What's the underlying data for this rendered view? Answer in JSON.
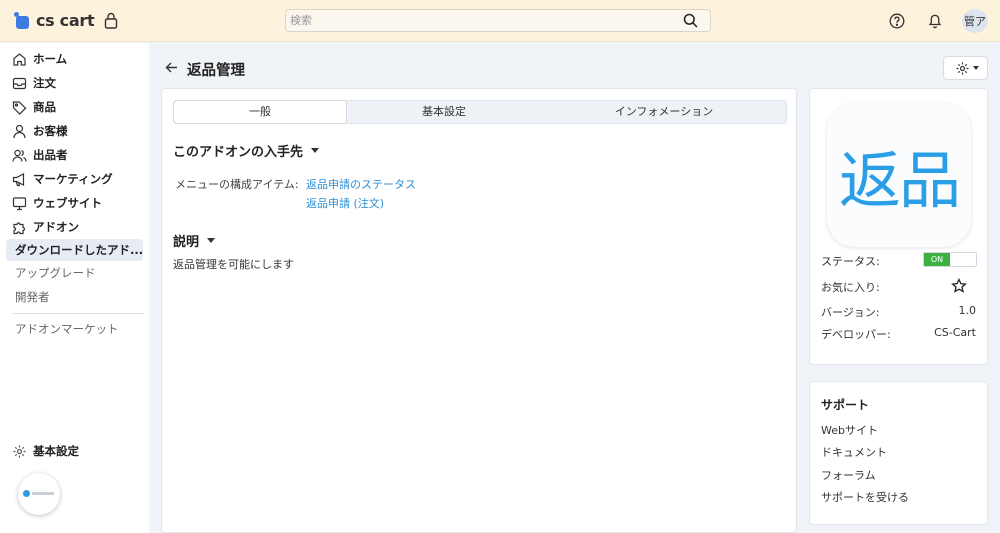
{
  "app": {
    "logo_text": "cs cart"
  },
  "search": {
    "placeholder": "検索"
  },
  "user": {
    "avatar_text": "管ア"
  },
  "sidebar": {
    "items": [
      {
        "label": "ホーム",
        "icon": "home-icon"
      },
      {
        "label": "注文",
        "icon": "inbox-icon"
      },
      {
        "label": "商品",
        "icon": "tag-icon"
      },
      {
        "label": "お客様",
        "icon": "user-icon"
      },
      {
        "label": "出品者",
        "icon": "users-icon"
      },
      {
        "label": "マーケティング",
        "icon": "megaphone-icon"
      },
      {
        "label": "ウェブサイト",
        "icon": "monitor-icon"
      },
      {
        "label": "アドオン",
        "icon": "puzzle-icon"
      }
    ],
    "active_label": "ダウンロードしたアド...",
    "sub_items": [
      "アップグレード",
      "開発者"
    ],
    "marketplace_label": "アドオンマーケット",
    "settings": {
      "label": "基本設定",
      "icon": "gear-icon"
    }
  },
  "page": {
    "title": "返品管理"
  },
  "tabs": [
    {
      "label": "一般",
      "active": true
    },
    {
      "label": "基本設定",
      "active": false
    },
    {
      "label": "インフォメーション",
      "active": false
    }
  ],
  "source_section": {
    "title": "このアドオンの入手先",
    "field_label": "メニューの構成アイテム:",
    "links": [
      "返品申請のステータス",
      "返品申請 (注文)"
    ]
  },
  "description_section": {
    "title": "説明",
    "text": "返品管理を可能にします"
  },
  "info": {
    "icon_text": "返品",
    "status_label": "ステータス:",
    "status_value": "ON",
    "favorite_label": "お気に入り:",
    "version_label": "バージョン:",
    "version_value": "1.0",
    "developer_label": "デベロッパー:",
    "developer_value": "CS-Cart"
  },
  "support": {
    "title": "サポート",
    "links": [
      "Webサイト",
      "ドキュメント",
      "フォーラム",
      "サポートを受ける"
    ]
  },
  "colors": {
    "accent": "#2a8fd6",
    "topbar": "#fdf3dc",
    "toggle_on": "#3cb043"
  }
}
